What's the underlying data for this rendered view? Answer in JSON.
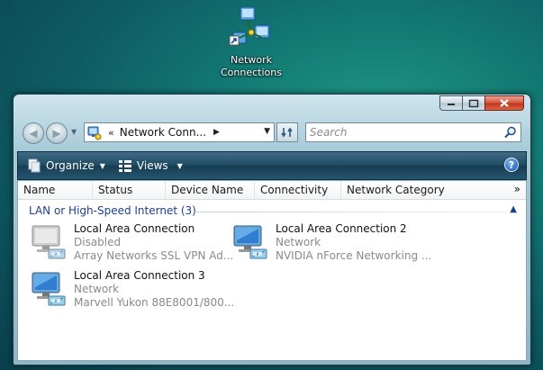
{
  "desktop": {
    "icon_label_line1": "Network",
    "icon_label_line2": "Connections"
  },
  "window": {
    "controls": [
      "minimize",
      "maximize",
      "close"
    ],
    "address": {
      "chevron": "«",
      "path": "Network Conn...",
      "arrow": "▶"
    },
    "search": {
      "placeholder": "Search"
    },
    "toolbar": {
      "organize_label": "Organize",
      "views_label": "Views",
      "help_label": "?"
    },
    "columns": [
      "Name",
      "Status",
      "Device Name",
      "Connectivity",
      "Network Category"
    ],
    "more_columns": "»",
    "group": {
      "title": "LAN or High-Speed Internet (3)",
      "collapse": "▲"
    },
    "items": [
      {
        "name": "Local Area Connection",
        "status": "Disabled",
        "device": "Array Networks SSL VPN Ad...",
        "icon": "network-adapter-disabled-icon"
      },
      {
        "name": "Local Area Connection 2",
        "status": "Network",
        "device": "NVIDIA nForce Networking ...",
        "icon": "network-adapter-icon"
      },
      {
        "name": "Local Area Connection 3",
        "status": "Network",
        "device": "Marvell Yukon 88E8001/800...",
        "icon": "network-adapter-icon"
      }
    ]
  }
}
